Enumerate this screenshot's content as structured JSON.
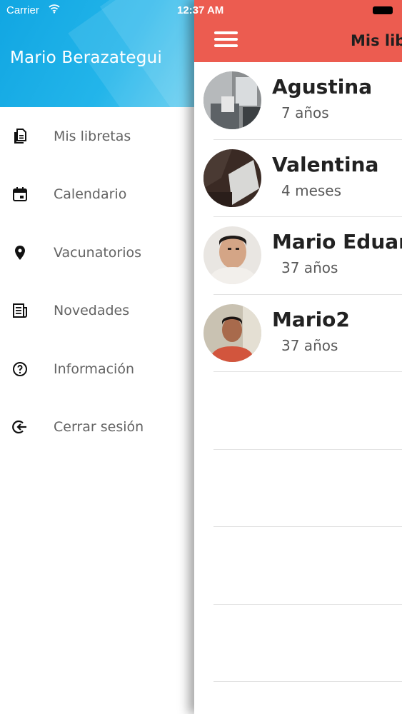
{
  "status_bar": {
    "carrier": "Carrier",
    "time": "12:37 AM"
  },
  "drawer": {
    "user_name": "Mario Berazategui",
    "items": [
      {
        "label": "Mis libretas",
        "icon": "notebooks-icon"
      },
      {
        "label": "Calendario",
        "icon": "calendar-icon"
      },
      {
        "label": "Vacunatorios",
        "icon": "location-pin-icon"
      },
      {
        "label": "Novedades",
        "icon": "news-icon"
      },
      {
        "label": "Información",
        "icon": "help-circle-icon"
      },
      {
        "label": "Cerrar sesión",
        "icon": "logout-icon"
      }
    ]
  },
  "main": {
    "title": "Mis libretas",
    "menu_icon": "hamburger-menu-icon",
    "accent_color": "#ec5c50",
    "profiles": [
      {
        "name": "Agustina",
        "age": "7 años"
      },
      {
        "name": "Valentina",
        "age": "4 meses"
      },
      {
        "name": "Mario Eduardo",
        "age": "37 años"
      },
      {
        "name": "Mario2",
        "age": "37 años"
      }
    ]
  },
  "colors": {
    "drawer_header": "#11a6e2",
    "nav_bar": "#ec5c50"
  }
}
